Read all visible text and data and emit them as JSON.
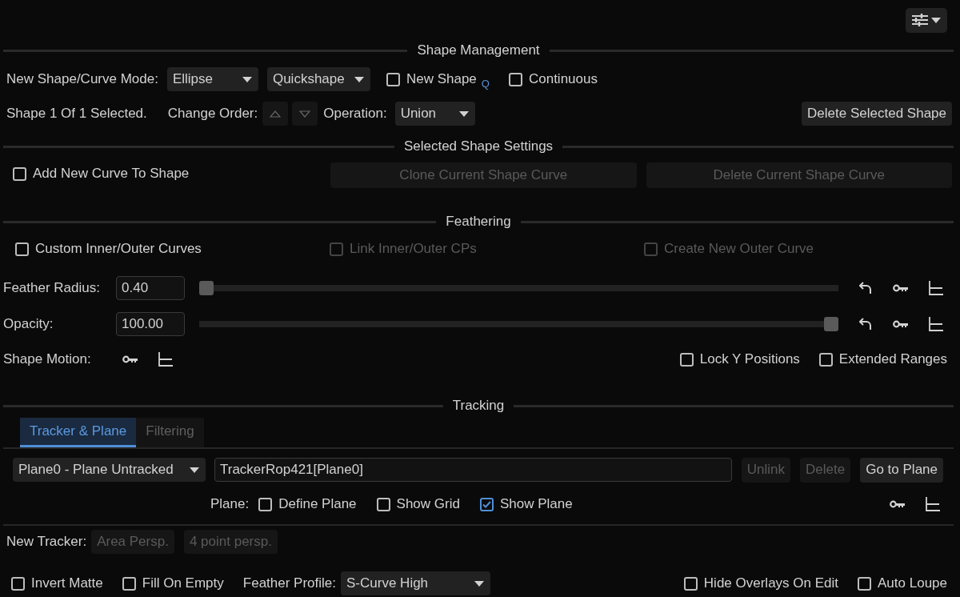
{
  "shape_management": {
    "title": "Shape Management",
    "mode_label": "New Shape/Curve Mode:",
    "mode_dropdowns": [
      {
        "value": "Ellipse"
      },
      {
        "value": "Quickshape"
      }
    ],
    "options": [
      {
        "label": "New Shape",
        "checked": false,
        "hotkey": "Q"
      },
      {
        "label": "Continuous",
        "checked": false
      }
    ],
    "selection_text": "Shape 1 Of 1 Selected.",
    "order_label": "Change Order:",
    "operation_label": "Operation:",
    "operation": "Union",
    "delete_button": "Delete Selected Shape"
  },
  "selected_shape_settings": {
    "title": "Selected Shape Settings",
    "add_curve": {
      "label": "Add New Curve To Shape",
      "checked": false
    },
    "buttons": [
      {
        "label": "Clone Current Shape Curve",
        "disabled": true
      },
      {
        "label": "Delete Current Shape Curve",
        "disabled": true
      }
    ]
  },
  "feathering": {
    "title": "Feathering",
    "checkboxes": [
      {
        "label": "Custom Inner/Outer Curves",
        "checked": false,
        "disabled": false
      },
      {
        "label": "Link Inner/Outer CPs",
        "checked": false,
        "disabled": true
      },
      {
        "label": "Create New Outer Curve",
        "checked": false,
        "disabled": true
      }
    ],
    "sliders": [
      {
        "label": "Feather Radius:",
        "value": "0.40",
        "level": 0.0
      },
      {
        "label": "Opacity:",
        "value": "100.00",
        "level": 1.0
      }
    ],
    "shape_motion_label": "Shape Motion:",
    "options": [
      {
        "label": "Lock Y Positions",
        "checked": false
      },
      {
        "label": "Extended Ranges",
        "checked": false
      }
    ]
  },
  "tracking": {
    "title": "Tracking",
    "tabs": [
      {
        "label": "Tracker & Plane",
        "selected": true
      },
      {
        "label": "Filtering",
        "selected": false
      }
    ],
    "plane_dropdown": "Plane0 - Plane Untracked",
    "tracker_name": "TrackerRop421[Plane0]",
    "buttons": [
      {
        "label": "Unlink",
        "disabled": true
      },
      {
        "label": "Delete",
        "disabled": true
      },
      {
        "label": "Go to Plane",
        "disabled": false
      }
    ],
    "plane_label": "Plane:",
    "plane_options": [
      {
        "label": "Define Plane",
        "checked": false
      },
      {
        "label": "Show Grid",
        "checked": false
      },
      {
        "label": "Show Plane",
        "checked": true
      }
    ],
    "new_tracker_label": "New Tracker:",
    "tracker_buttons": [
      {
        "label": "Area Persp.",
        "disabled": true
      },
      {
        "label": "4 point persp.",
        "disabled": true
      }
    ]
  },
  "footer": {
    "left_options": [
      {
        "label": "Invert Matte",
        "checked": false
      },
      {
        "label": "Fill On Empty",
        "checked": false
      }
    ],
    "feather_profile_label": "Feather Profile:",
    "feather_profile": "S-Curve High",
    "right_options": [
      {
        "label": "Hide Overlays On Edit",
        "checked": false
      },
      {
        "label": "Auto Loupe",
        "checked": false
      }
    ]
  }
}
